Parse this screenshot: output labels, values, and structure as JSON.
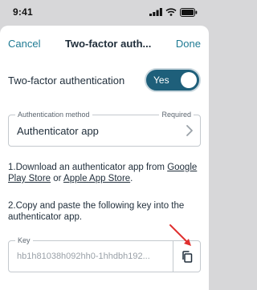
{
  "status_bar": {
    "time": "9:41"
  },
  "nav": {
    "cancel_label": "Cancel",
    "title": "Two-factor auth...",
    "done_label": "Done"
  },
  "two_factor": {
    "label": "Two-factor authentication",
    "toggle_label": "Yes",
    "enabled": true
  },
  "auth_method": {
    "legend": "Authentication method",
    "required": "Required",
    "value": "Authenticator app"
  },
  "step1": {
    "text_before": "1.Download an authenticator app from ",
    "link1": "Google Play Store",
    "text_middle": " or ",
    "link2": "Apple App Store",
    "text_after": "."
  },
  "step2": {
    "text": "2.Copy and paste the following key into the authenticator app."
  },
  "key_field": {
    "legend": "Key",
    "value": "hb1h81038h092hh0-1hhdbh192..."
  },
  "colors": {
    "accent": "#1e7a93",
    "toggle_bg": "#1e5f7a",
    "annotation_arrow": "#e0302f"
  }
}
